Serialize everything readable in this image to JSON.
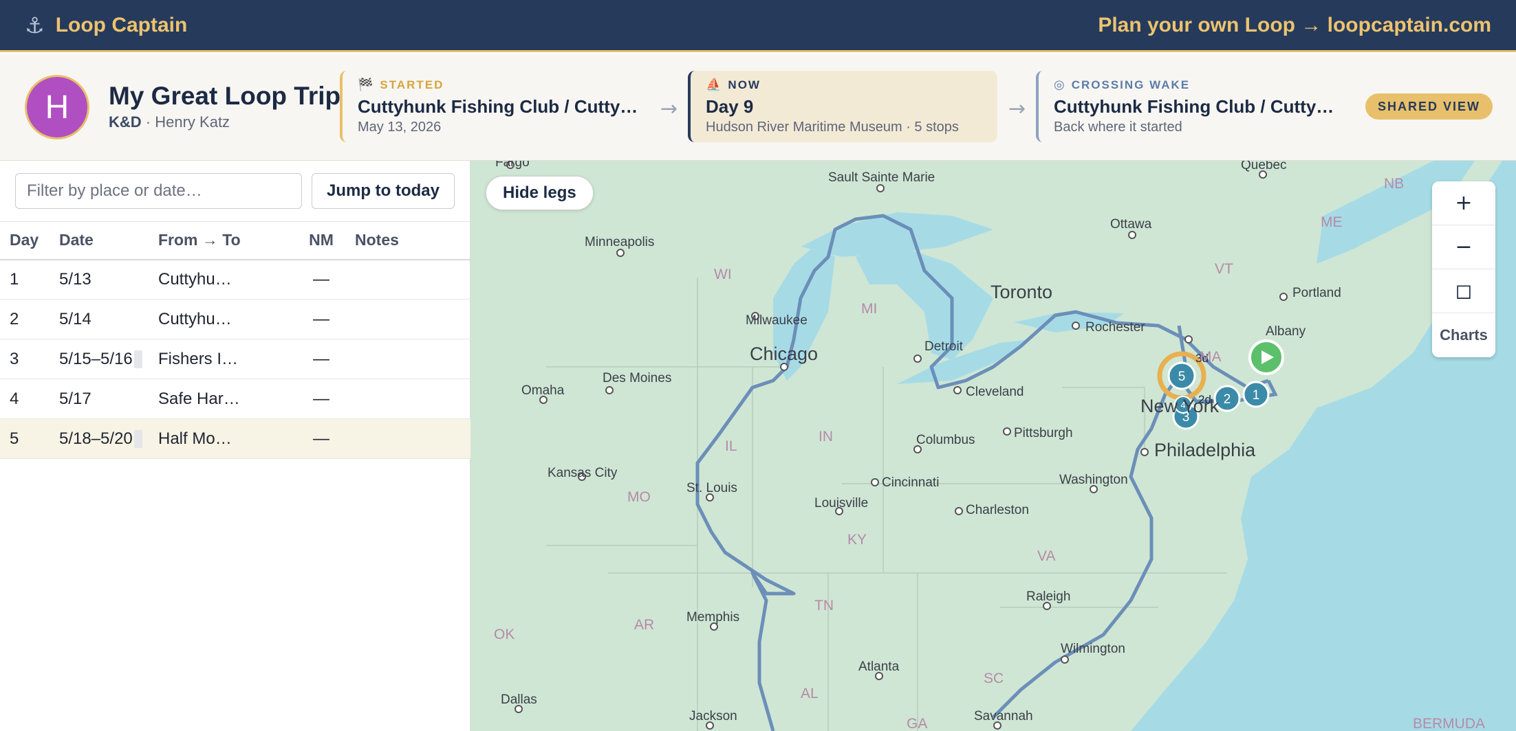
{
  "topbar": {
    "brand_icon": "anchor-icon",
    "brand": "Loop Captain",
    "plan_link": "Plan your own Loop → loopcaptain.com"
  },
  "trip": {
    "avatar_initial": "H",
    "title": "My Great Loop Trip",
    "boat": "K&D",
    "owner": "· Henry Katz",
    "started": {
      "icon": "checkered-flag-icon",
      "kicker": "STARTED",
      "headline": "Cuttyhunk Fishing Club / Cuttyhunk Island, MA",
      "sub": "May 13, 2026"
    },
    "now": {
      "icon": "boat-icon",
      "kicker": "NOW",
      "headline": "Day 9",
      "sub": "Hudson River Maritime Museum · 5 stops"
    },
    "crossing": {
      "icon": "target-icon",
      "kicker": "CROSSING WAKE",
      "headline": "Cuttyhunk Fishing Club / Cuttyhunk Island, MA",
      "sub": "Back where it started"
    },
    "badge": "SHARED VIEW"
  },
  "legs": {
    "filter_placeholder": "Filter by place or date…",
    "jump_label": "Jump to today",
    "columns": [
      "Day",
      "Date",
      "From → To",
      "NM",
      "Notes"
    ],
    "rows": [
      {
        "day": "1",
        "date": "5/13",
        "route": "Cuttyhunk Fishing Club",
        "nm": "—",
        "notes": "",
        "multi": false
      },
      {
        "day": "2",
        "date": "5/14",
        "route": "Cuttyhunk Fishing Club",
        "nm": "—",
        "notes": "",
        "multi": false
      },
      {
        "day": "3",
        "date": "5/15–5/16",
        "route": "Fishers Island",
        "nm": "—",
        "notes": "",
        "multi": true
      },
      {
        "day": "4",
        "date": "5/17",
        "route": "Safe Harbor Marina",
        "nm": "—",
        "notes": "",
        "multi": false
      },
      {
        "day": "5",
        "date": "5/18–5/20",
        "route": "Half Moon Bay Marina",
        "nm": "—",
        "notes": "",
        "multi": true
      }
    ]
  },
  "map": {
    "hide_legs_label": "Hide legs",
    "zoom_in": "+",
    "zoom_out": "−",
    "fit": "◻",
    "charts": "Charts",
    "colors": {
      "water": "#a6dbe6",
      "land": "#cfe6d4",
      "route": "#6b8fb8",
      "marker": "#3b8aa8",
      "start": "#5cc06a",
      "current": "#e8b04f"
    },
    "cities": [
      {
        "name": "Fargo",
        "big": false
      },
      {
        "name": "Sault Sainte Marie",
        "big": false
      },
      {
        "name": "Quebec",
        "big": false
      },
      {
        "name": "Ottawa",
        "big": false
      },
      {
        "name": "Minneapolis",
        "big": false
      },
      {
        "name": "Toronto",
        "big": true
      },
      {
        "name": "Milwaukee",
        "big": false
      },
      {
        "name": "Rochester",
        "big": false
      },
      {
        "name": "Albany",
        "big": false
      },
      {
        "name": "Portland",
        "big": false
      },
      {
        "name": "Chicago",
        "big": true
      },
      {
        "name": "Detroit",
        "big": false
      },
      {
        "name": "Des Moines",
        "big": false
      },
      {
        "name": "Omaha",
        "big": false
      },
      {
        "name": "Cleveland",
        "big": false
      },
      {
        "name": "Pittsburgh",
        "big": false
      },
      {
        "name": "Philadelphia",
        "big": true
      },
      {
        "name": "New York",
        "big": true
      },
      {
        "name": "Columbus",
        "big": false
      },
      {
        "name": "Kansas City",
        "big": false
      },
      {
        "name": "Cincinnati",
        "big": false
      },
      {
        "name": "Washington",
        "big": false
      },
      {
        "name": "St. Louis",
        "big": false
      },
      {
        "name": "Louisville",
        "big": false
      },
      {
        "name": "Charleston",
        "big": false
      },
      {
        "name": "Raleigh",
        "big": false
      },
      {
        "name": "Memphis",
        "big": false
      },
      {
        "name": "Wilmington",
        "big": false
      },
      {
        "name": "Atlanta",
        "big": false
      },
      {
        "name": "Dallas",
        "big": false
      },
      {
        "name": "Jackson",
        "big": false
      },
      {
        "name": "Savannah",
        "big": false
      }
    ],
    "regions": [
      "NB",
      "ME",
      "VT",
      "MA",
      "WI",
      "MI",
      "IL",
      "IN",
      "MO",
      "KY",
      "VA",
      "TN",
      "AR",
      "OK",
      "AL",
      "SC",
      "GA",
      "BERMUDA"
    ],
    "stops": [
      "1",
      "2",
      "3",
      "4",
      "5"
    ],
    "durations": [
      "3d",
      "2d"
    ]
  }
}
